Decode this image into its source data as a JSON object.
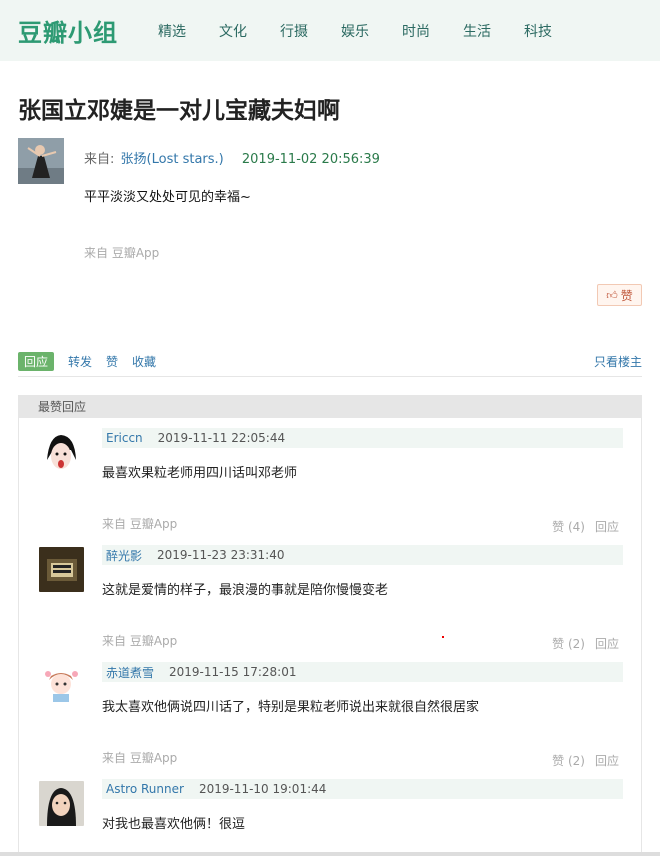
{
  "topbar": {
    "logo": "豆瓣小组",
    "nav": [
      "精选",
      "文化",
      "行摄",
      "娱乐",
      "时尚",
      "生活",
      "科技"
    ]
  },
  "post": {
    "title": "张国立邓婕是一对儿宝藏夫妇啊",
    "from_label": "来自:",
    "author": "张扬(Lost stars.)",
    "time": "2019-11-02 20:56:39",
    "body": "平平淡淡又处处可见的幸福~",
    "source": "来自 豆瓣App",
    "like_label": "赞",
    "like_icon": "thumbs-up-icon"
  },
  "actions": {
    "reply": "回应",
    "repost": "转发",
    "like": "赞",
    "collect": "收藏",
    "only_op": "只看楼主"
  },
  "best_replies": {
    "header": "最赞回应",
    "comments": [
      {
        "name": "Ericcn",
        "time": "2019-11-11 22:05:44",
        "text": "最喜欢果粒老师用四川话叫邓老师",
        "source": "来自 豆瓣App",
        "likes": "赞 (4)",
        "reply": "回应"
      },
      {
        "name": "醉光影",
        "time": "2019-11-23 23:31:40",
        "text": "这就是爱情的样子，最浪漫的事就是陪你慢慢变老",
        "source": "来自 豆瓣App",
        "likes": "赞 (2)",
        "reply": "回应"
      },
      {
        "name": "赤道煮雪",
        "time": "2019-11-15 17:28:01",
        "text": "我太喜欢他俩说四川话了，特别是果粒老师说出来就很自然很居家",
        "source": "来自 豆瓣App",
        "likes": "赞 (2)",
        "reply": "回应"
      },
      {
        "name": "Astro Runner",
        "time": "2019-11-10 19:01:44",
        "text": "对我也最喜欢他俩！很逗",
        "source": "",
        "likes": "",
        "reply": ""
      }
    ]
  },
  "colors": {
    "brand": "#2d9a73",
    "link": "#3377aa",
    "reply_green": "#6bb36b"
  }
}
